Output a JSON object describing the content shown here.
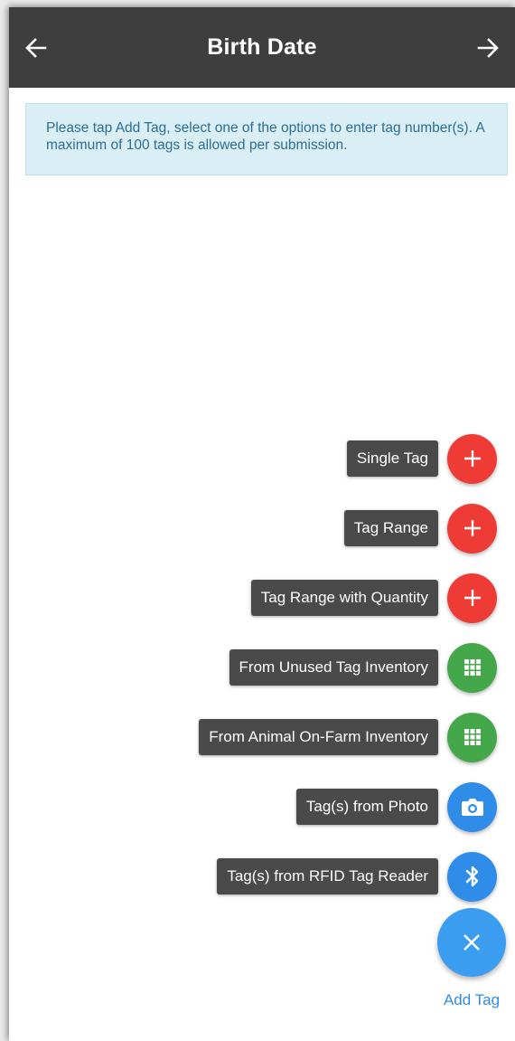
{
  "header": {
    "title": "Birth Date",
    "back_icon": "arrow-left-icon",
    "forward_icon": "arrow-right-icon"
  },
  "info_message": "Please tap Add Tag, select one of the options to enter tag number(s). A maximum of 100 tags is allowed per submission.",
  "speed_dial": {
    "items": [
      {
        "label": "Single Tag",
        "icon": "plus-icon",
        "color": "#ef3b35"
      },
      {
        "label": "Tag Range",
        "icon": "plus-icon",
        "color": "#ef3b35"
      },
      {
        "label": "Tag Range with Quantity",
        "icon": "plus-icon",
        "color": "#ef3b35"
      },
      {
        "label": "From Unused Tag Inventory",
        "icon": "grid-icon",
        "color": "#44a84a"
      },
      {
        "label": "From Animal On-Farm Inventory",
        "icon": "grid-icon",
        "color": "#44a84a"
      },
      {
        "label": "Tag(s) from Photo",
        "icon": "camera-icon",
        "color": "#2f8ce9"
      },
      {
        "label": "Tag(s) from RFID Tag Reader",
        "icon": "bluetooth-icon",
        "color": "#2f8ce9"
      }
    ],
    "main_button": {
      "label": "Add Tag",
      "icon": "close-icon",
      "color": "#3b9df0"
    }
  }
}
